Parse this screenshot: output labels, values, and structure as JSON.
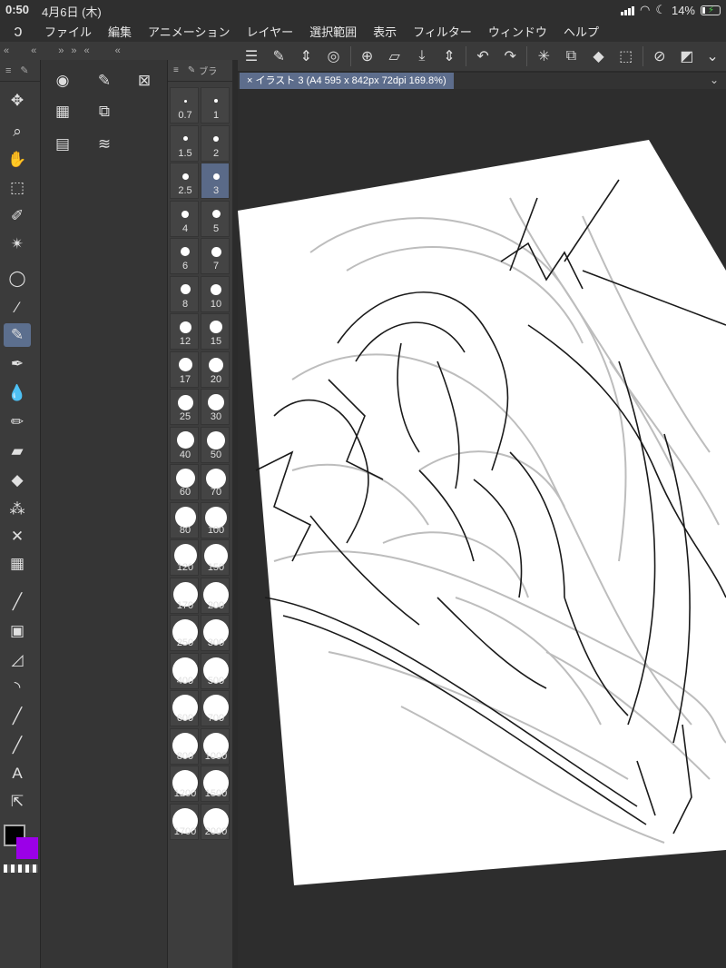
{
  "status": {
    "time": "0:50",
    "date": "4月6日 (木)",
    "battery": "14%"
  },
  "menu": [
    "ファイル",
    "編集",
    "アニメーション",
    "レイヤー",
    "選択範囲",
    "表示",
    "フィルター",
    "ウィンドウ",
    "ヘルプ"
  ],
  "panel_headers": [
    "«",
    "»",
    "«",
    "»",
    "«",
    "«"
  ],
  "brush_tab_label": "ブラ",
  "canvas_tab": "イラスト 3 (A4 595 x 842px 72dpi 169.8%)",
  "brush_sizes": [
    "0.7",
    "1",
    "1.5",
    "2",
    "2.5",
    "3",
    "4",
    "5",
    "6",
    "7",
    "8",
    "10",
    "12",
    "15",
    "17",
    "20",
    "25",
    "30",
    "40",
    "50",
    "60",
    "70",
    "80",
    "100",
    "120",
    "150",
    "170",
    "200",
    "250",
    "300",
    "400",
    "500",
    "600",
    "700",
    "800",
    "1000",
    "1200",
    "1500",
    "1700",
    "2000"
  ],
  "selected_brush_size": "3",
  "colors": {
    "main": "#000000",
    "sub": "#9b00e8",
    "accent": "#5c6f8e"
  },
  "tools": [
    "move-icon",
    "zoom-icon",
    "hand-icon",
    "object-icon",
    "selection-pen-icon",
    "magic-wand-icon",
    "lasso-icon",
    "eyedropper-icon",
    "pen-icon",
    "pencil-icon",
    "blend-icon",
    "airbrush-icon",
    "eraser-icon",
    "fill-icon",
    "decoration-icon",
    "gradient-icon",
    "figure-icon",
    "frame-icon",
    "ruler-icon",
    "curve-icon",
    "line-icon",
    "line2-icon",
    "text-icon",
    "operation-icon"
  ],
  "active_tool_index": 7
}
